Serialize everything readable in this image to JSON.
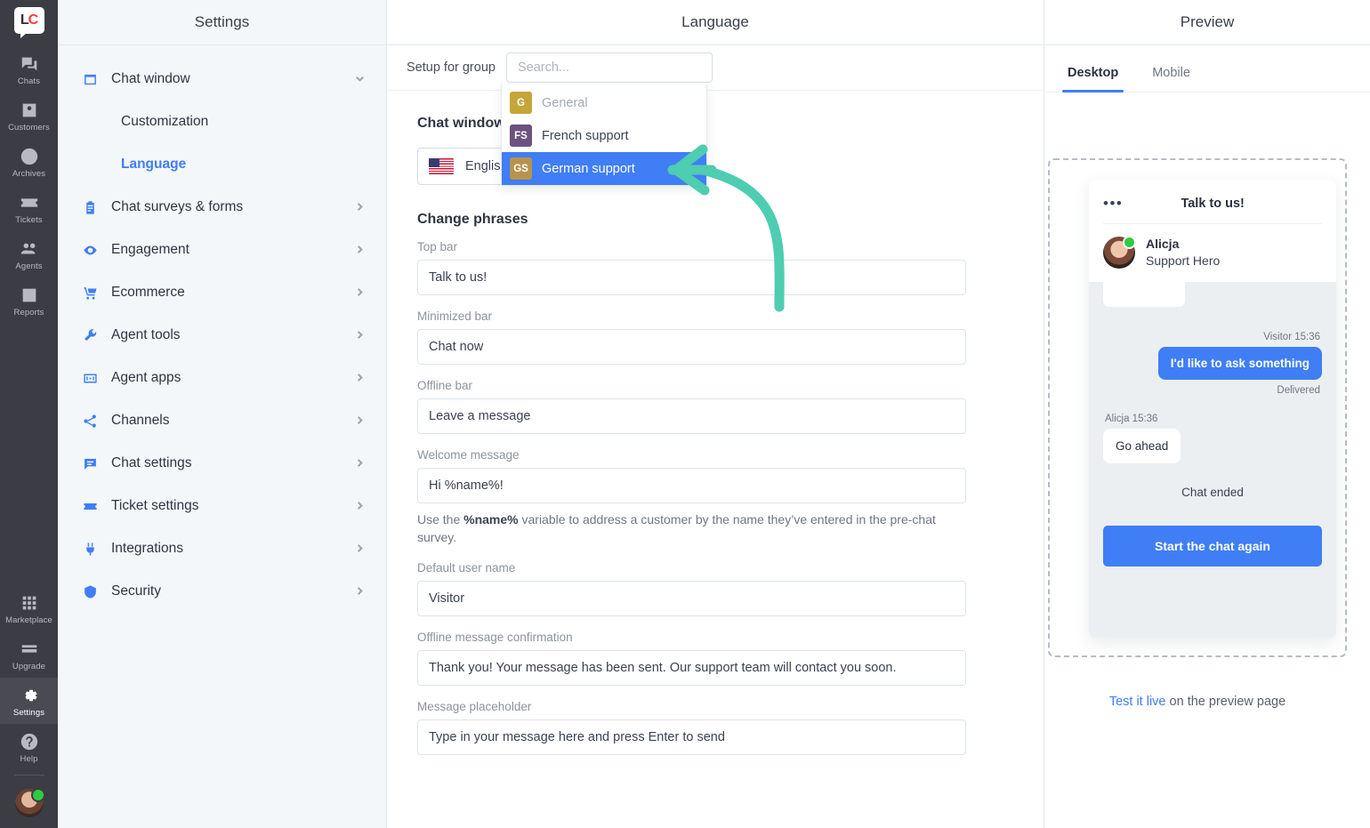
{
  "nav": {
    "logo": {
      "left": "L",
      "right": "C"
    },
    "items": [
      {
        "label": "Chats",
        "icon": "chats-icon",
        "active": false
      },
      {
        "label": "Customers",
        "icon": "customers-icon",
        "active": false
      },
      {
        "label": "Archives",
        "icon": "archives-icon",
        "active": false
      },
      {
        "label": "Tickets",
        "icon": "tickets-icon",
        "active": false
      },
      {
        "label": "Agents",
        "icon": "agents-icon",
        "active": false
      },
      {
        "label": "Reports",
        "icon": "reports-icon",
        "active": false
      }
    ],
    "bottom_items": [
      {
        "label": "Marketplace",
        "icon": "marketplace-icon",
        "active": false
      },
      {
        "label": "Upgrade",
        "icon": "upgrade-icon",
        "active": false
      },
      {
        "label": "Settings",
        "icon": "gear-icon",
        "active": true
      },
      {
        "label": "Help",
        "icon": "question-icon",
        "active": false
      }
    ]
  },
  "settings": {
    "title": "Settings",
    "items": [
      {
        "label": "Chat window",
        "icon": "window-icon",
        "expanded": true,
        "chevron": "down"
      },
      {
        "label": "Chat surveys & forms",
        "icon": "clipboard-icon",
        "chevron": "right"
      },
      {
        "label": "Engagement",
        "icon": "eye-icon",
        "chevron": "right"
      },
      {
        "label": "Ecommerce",
        "icon": "cart-icon",
        "chevron": "right"
      },
      {
        "label": "Agent tools",
        "icon": "wrench-icon",
        "chevron": "right"
      },
      {
        "label": "Agent apps",
        "icon": "apps-icon",
        "chevron": "right"
      },
      {
        "label": "Channels",
        "icon": "share-icon",
        "chevron": "right"
      },
      {
        "label": "Chat settings",
        "icon": "chat-icon",
        "chevron": "right"
      },
      {
        "label": "Ticket settings",
        "icon": "ticket-icon",
        "chevron": "right"
      },
      {
        "label": "Integrations",
        "icon": "plug-icon",
        "chevron": "right"
      },
      {
        "label": "Security",
        "icon": "shield-icon",
        "chevron": "right"
      }
    ],
    "sub_items": [
      {
        "label": "Customization",
        "selected": false
      },
      {
        "label": "Language",
        "selected": true
      }
    ]
  },
  "main": {
    "title": "Language",
    "setup_label": "Setup for group",
    "search_placeholder": "Search...",
    "search_value": "",
    "dropdown": {
      "options": [
        {
          "initials": "G",
          "label": "General",
          "color": "#c6a53a",
          "state": "muted"
        },
        {
          "initials": "FS",
          "label": "French support",
          "color": "#6d5280",
          "state": "normal"
        },
        {
          "initials": "GS",
          "label": "German support",
          "color": "#b8924d",
          "state": "highlighted"
        }
      ],
      "highlight_color": "#3f7ef5"
    },
    "section_title": "Chat window language",
    "language_select": {
      "value": "English",
      "flag": "us-flag-icon"
    },
    "phrases_title": "Change phrases",
    "fields": [
      {
        "label": "Top bar",
        "value": "Talk to us!"
      },
      {
        "label": "Minimized bar",
        "value": "Chat now"
      },
      {
        "label": "Offline bar",
        "value": "Leave a message"
      },
      {
        "label": "Welcome message",
        "value": "Hi %name%!"
      },
      {
        "label": "Default user name",
        "value": "Visitor"
      },
      {
        "label": "Offline message confirmation",
        "value": "Thank you! Your message has been sent. Our support team will contact you soon."
      },
      {
        "label": "Message placeholder",
        "value": "Type in your message here and press Enter to send"
      }
    ],
    "welcome_help": {
      "before": "Use the ",
      "variable": "%name%",
      "after": " variable to address a customer by the name they’ve entered in the pre-chat survey."
    },
    "annotation": {
      "type": "curved-arrow",
      "color": "#4ecdb0",
      "points_to": "German support"
    }
  },
  "preview": {
    "title": "Preview",
    "tabs": [
      {
        "label": "Desktop",
        "active": true
      },
      {
        "label": "Mobile",
        "active": false
      }
    ],
    "widget": {
      "menu_icon": "•••",
      "title": "Talk to us!",
      "agent": {
        "name": "Alicja",
        "role": "Support Hero",
        "status": "online"
      },
      "messages": [
        {
          "side": "right",
          "meta": "Visitor 15:36",
          "text": "I'd like to ask something",
          "status": "Delivered"
        },
        {
          "side": "left",
          "meta": "Alicja 15:36",
          "text": "Go ahead"
        }
      ],
      "chat_ended": "Chat ended",
      "restart_button": "Start the chat again"
    },
    "footer": {
      "link": "Test it live",
      "rest": " on the preview page"
    }
  }
}
